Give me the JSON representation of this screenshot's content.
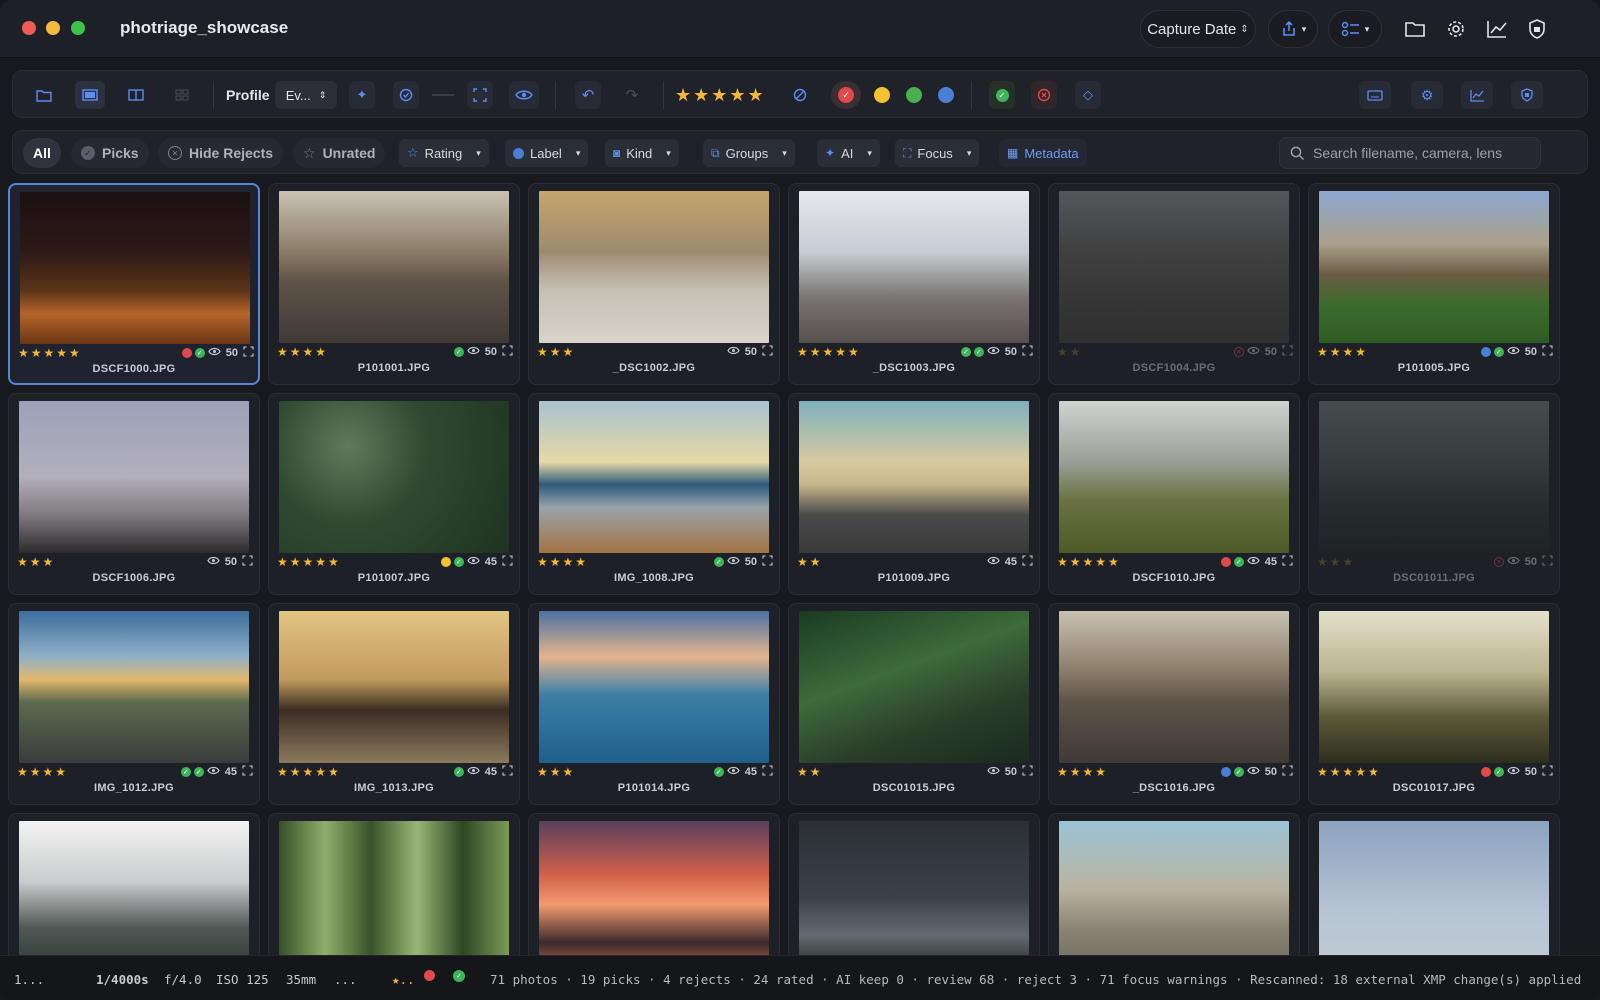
{
  "window": {
    "title": "photriage_showcase"
  },
  "titlebar": {
    "sort_label": "Capture Date",
    "icons": [
      "share-icon",
      "checklist-icon",
      "folder-icon",
      "gear-icon",
      "chart-icon",
      "shield-icon"
    ]
  },
  "toolbar": {
    "profile_label": "Profile",
    "profile_value": "Ev...",
    "star_rating": 5,
    "color_labels": [
      "#e04a4a",
      "#f2c230",
      "#4caf50",
      "#4a7fd6"
    ],
    "colors": {
      "accent": "#5a84d6",
      "star": "#f4b63b",
      "green": "#3fb55a",
      "red": "#e04a4a"
    }
  },
  "filters": {
    "all": "All",
    "picks": "Picks",
    "hide_rejects": "Hide Rejects",
    "unrated": "Unrated",
    "rating": "Rating",
    "label": "Label",
    "kind": "Kind",
    "groups": "Groups",
    "ai": "AI",
    "focus": "Focus",
    "metadata": "Metadata",
    "search_placeholder": "Search filename, camera, lens"
  },
  "photos": [
    {
      "name": "DSCF1000.JPG",
      "stars": "★★★★★",
      "score": "50",
      "labels": [
        "red",
        "green",
        "eye"
      ],
      "selected": true
    },
    {
      "name": "P101001.JPG",
      "stars": "★★★★",
      "score": "50",
      "labels": [
        "green",
        "eye"
      ]
    },
    {
      "name": "_DSC1002.JPG",
      "stars": "★★★",
      "score": "50",
      "labels": [
        "eye"
      ]
    },
    {
      "name": "_DSC1003.JPG",
      "stars": "★★★★★",
      "score": "50",
      "labels": [
        "green",
        "green",
        "eye"
      ]
    },
    {
      "name": "DSCF1004.JPG",
      "stars": "★★",
      "score": "50",
      "labels": [
        "reject",
        "eye"
      ],
      "dim": true
    },
    {
      "name": "P101005.JPG",
      "stars": "★★★★",
      "score": "50",
      "labels": [
        "blue",
        "green",
        "eye"
      ]
    },
    {
      "name": "DSCF1006.JPG",
      "stars": "★★★",
      "score": "50",
      "labels": [
        "eye"
      ]
    },
    {
      "name": "P101007.JPG",
      "stars": "★★★★★",
      "score": "45",
      "labels": [
        "yellow",
        "green",
        "eye"
      ]
    },
    {
      "name": "IMG_1008.JPG",
      "stars": "★★★★",
      "score": "50",
      "labels": [
        "green",
        "eye"
      ]
    },
    {
      "name": "P101009.JPG",
      "stars": "★★",
      "score": "45",
      "labels": [
        "eye"
      ]
    },
    {
      "name": "DSCF1010.JPG",
      "stars": "★★★★★",
      "score": "45",
      "labels": [
        "red",
        "green",
        "eye"
      ]
    },
    {
      "name": "DSC01011.JPG",
      "stars": "★★★",
      "score": "50",
      "labels": [
        "reject",
        "eye"
      ],
      "dim": true
    },
    {
      "name": "IMG_1012.JPG",
      "stars": "★★★★",
      "score": "45",
      "labels": [
        "green",
        "green",
        "eye"
      ]
    },
    {
      "name": "IMG_1013.JPG",
      "stars": "★★★★★",
      "score": "45",
      "labels": [
        "green",
        "eye"
      ]
    },
    {
      "name": "P101014.JPG",
      "stars": "★★★",
      "score": "45",
      "labels": [
        "green",
        "eye"
      ]
    },
    {
      "name": "DSC01015.JPG",
      "stars": "★★",
      "score": "50",
      "labels": [
        "eye"
      ]
    },
    {
      "name": "_DSC1016.JPG",
      "stars": "★★★★",
      "score": "50",
      "labels": [
        "blue",
        "green",
        "eye"
      ]
    },
    {
      "name": "DSC01017.JPG",
      "stars": "★★★★★",
      "score": "50",
      "labels": [
        "red",
        "green",
        "eye"
      ]
    },
    {
      "name": "",
      "stars": "",
      "score": "",
      "labels": []
    },
    {
      "name": "",
      "stars": "",
      "score": "",
      "labels": []
    },
    {
      "name": "",
      "stars": "",
      "score": "",
      "labels": []
    },
    {
      "name": "",
      "stars": "",
      "score": "",
      "labels": []
    },
    {
      "name": "",
      "stars": "",
      "score": "",
      "labels": []
    },
    {
      "name": "",
      "stars": "",
      "score": "",
      "labels": []
    }
  ],
  "status": {
    "index": "1...",
    "shutter": "1/4000s",
    "aperture": "f/4.0",
    "iso": "ISO 125",
    "focal": "35mm",
    "more": "...",
    "star_mark": "★..",
    "summary": "71 photos · 19 picks · 4 rejects · 24 rated · AI keep 0 · review 68 · reject 3 · 71 focus warnings · Rescanned: 18 external XMP change(s) applied"
  }
}
